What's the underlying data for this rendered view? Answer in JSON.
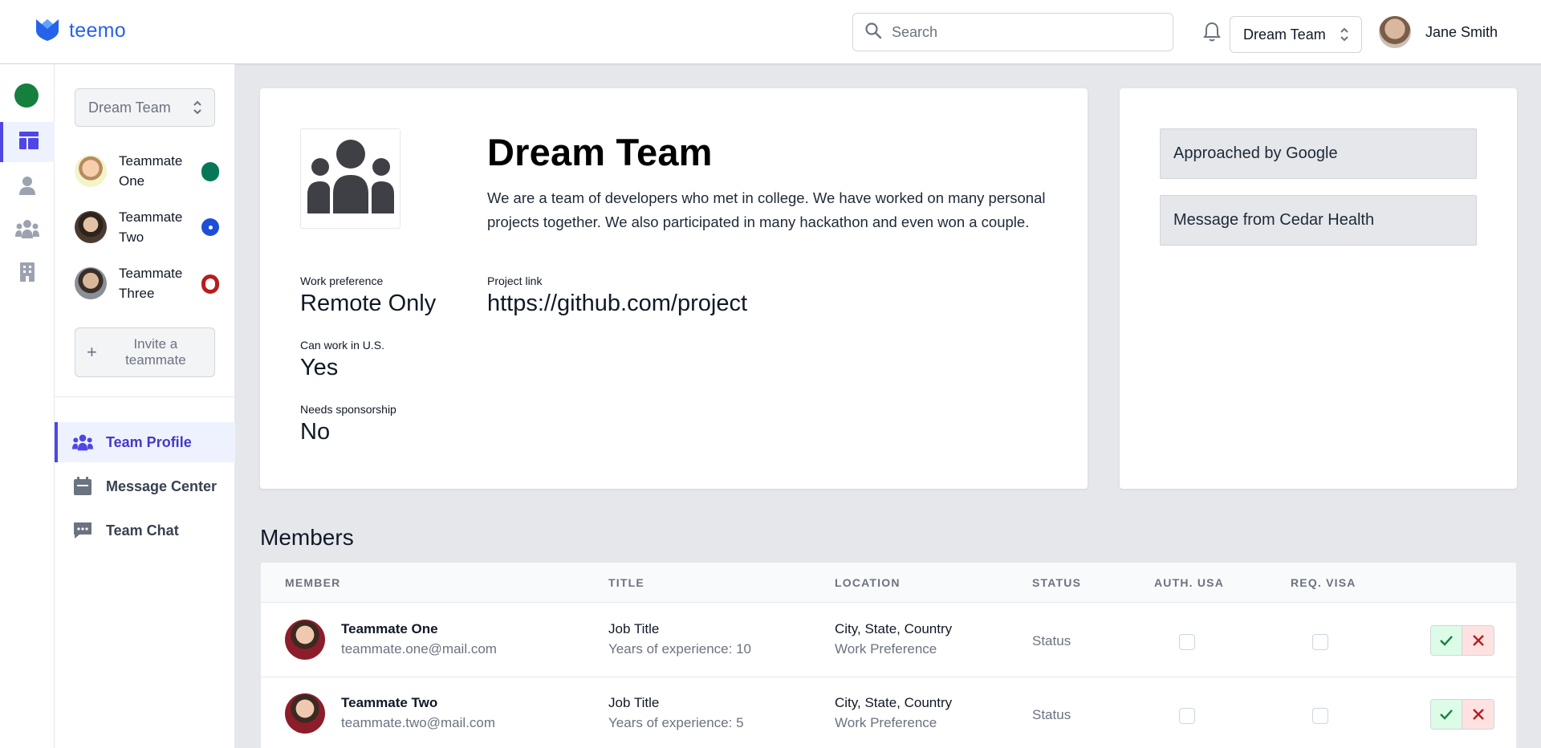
{
  "app": {
    "name": "teemo"
  },
  "header": {
    "search_placeholder": "Search",
    "team_select": "Dream Team",
    "user_name": "Jane Smith"
  },
  "sidebar": {
    "team_select": "Dream Team",
    "teammates": [
      {
        "name": "Teammate One",
        "status_color": "#047857"
      },
      {
        "name": "Teammate Two",
        "status_color": "#1d4ed8"
      },
      {
        "name": "Teammate Three",
        "status_color": "#b91c1c"
      }
    ],
    "invite_label": "Invite a teammate",
    "nav": [
      {
        "label": "Team Profile"
      },
      {
        "label": "Message Center"
      },
      {
        "label": "Team Chat"
      }
    ]
  },
  "profile": {
    "title": "Dream Team",
    "description": "We are a team of developers who met in college. We have worked on many personal projects together. We also participated in many hackathon and even won a couple.",
    "work_preference_label": "Work preference",
    "work_preference": "Remote Only",
    "can_work_us_label": "Can work in U.S.",
    "can_work_us": "Yes",
    "sponsorship_label": "Needs sponsorship",
    "sponsorship": "No",
    "project_link_label": "Project link",
    "project_link": "https://github.com/project"
  },
  "messages": [
    {
      "label": "Approached by Google"
    },
    {
      "label": "Message from Cedar Health"
    }
  ],
  "members": {
    "heading": "Members",
    "columns": [
      "MEMBER",
      "TITLE",
      "LOCATION",
      "STATUS",
      "AUTH. USA",
      "REQ. VISA"
    ],
    "rows": [
      {
        "name": "Teammate One",
        "email": "teammate.one@mail.com",
        "title": "Job Title",
        "experience": "Years of experience: 10",
        "location": "City, State, Country",
        "work_pref": "Work Preference",
        "status": "Status",
        "auth_usa": false,
        "req_visa": false
      },
      {
        "name": "Teammate Two",
        "email": "teammate.two@mail.com",
        "title": "Job Title",
        "experience": "Years of experience: 5",
        "location": "City, State, Country",
        "work_pref": "Work Preference",
        "status": "Status",
        "auth_usa": false,
        "req_visa": false
      }
    ]
  },
  "colors": {
    "accent": "#4f46e5",
    "brand": "#2563eb",
    "online": "#15803d"
  }
}
